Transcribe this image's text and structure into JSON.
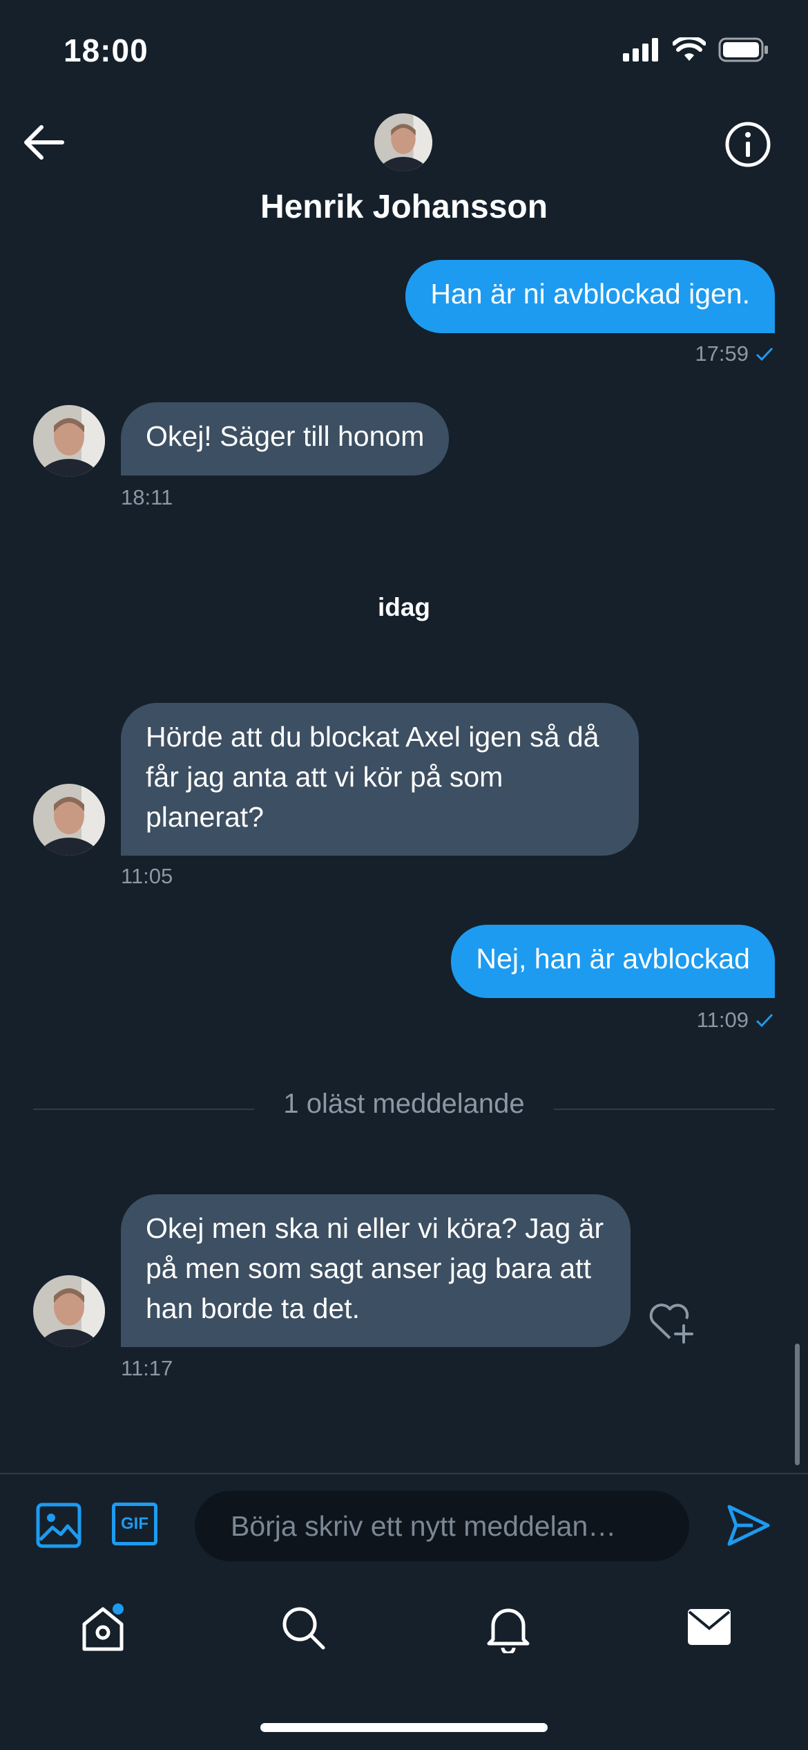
{
  "status_bar": {
    "time": "18:00"
  },
  "header": {
    "contact_name": "Henrik Johansson"
  },
  "messages": [
    {
      "direction": "out",
      "text": "Han är ni avblockad igen.",
      "time": "17:59",
      "read": true
    },
    {
      "direction": "in",
      "text": "Okej! Säger till honom",
      "time": "18:11"
    },
    {
      "direction": "in",
      "text": "Hörde att du blockat Axel igen så då får jag anta att vi kör på som planerat?",
      "time": "11:05"
    },
    {
      "direction": "out",
      "text": "Nej, han är avblockad",
      "time": "11:09",
      "read": true
    },
    {
      "direction": "in",
      "text": "Okej men ska ni eller vi köra? Jag är på men som sagt anser jag bara att han borde ta det.",
      "time": "11:17"
    }
  ],
  "day_separator": "idag",
  "unread_divider": "1 oläst meddelande",
  "composer": {
    "placeholder": "Börja skriv ett nytt meddelan…",
    "gif_label": "GIF"
  },
  "colors": {
    "accent": "#1d9bf0",
    "background": "#15202b",
    "incoming_bubble": "#3d4f62",
    "muted_text": "#8b98a5"
  },
  "icons": [
    "back-arrow-icon",
    "info-icon",
    "image-icon",
    "gif-icon",
    "send-icon",
    "home-icon",
    "search-icon",
    "bell-icon",
    "mail-icon",
    "heart-plus-icon",
    "checkmark-icon",
    "cellular-icon",
    "wifi-icon",
    "battery-icon"
  ]
}
